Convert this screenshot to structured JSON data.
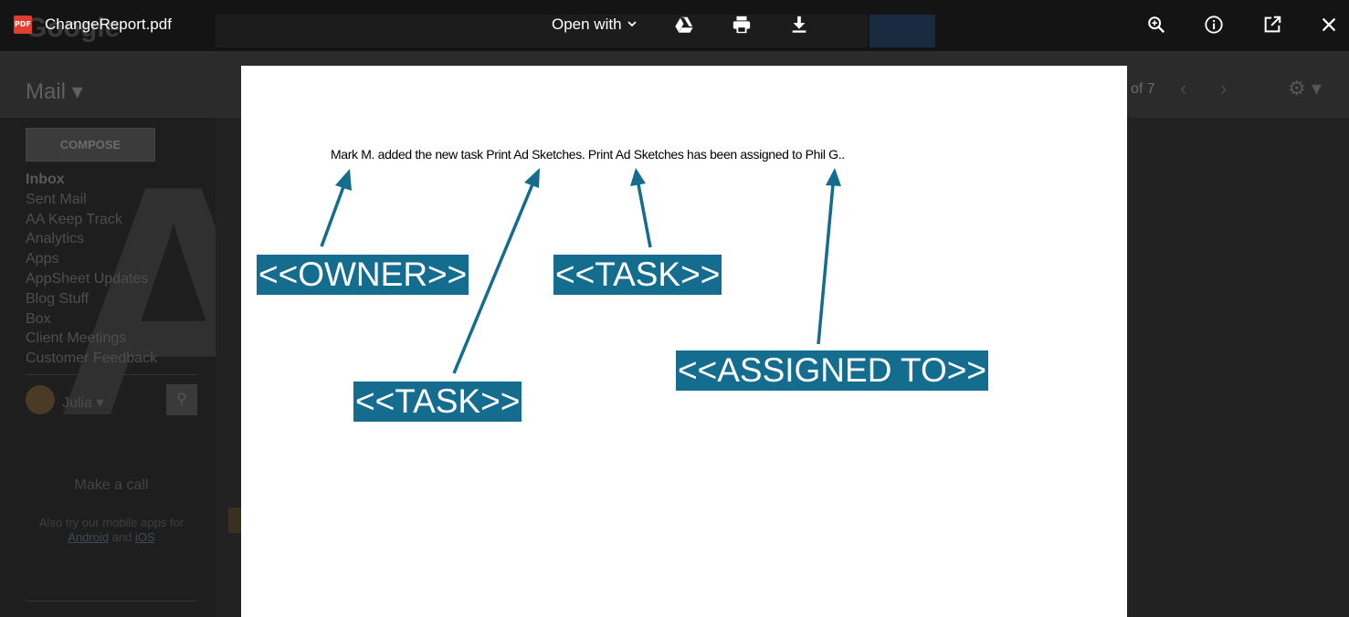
{
  "viewer": {
    "file_icon": "PDF",
    "filename": "ChangeReport.pdf",
    "open_with_label": "Open with",
    "toolbar_icons": [
      "drive-icon",
      "print-icon",
      "download-icon",
      "zoom-in-icon",
      "info-icon",
      "open-in-new-window-icon",
      "close-icon"
    ]
  },
  "document": {
    "sentence": "Mark M. added the new task Print Ad Sketches. Print Ad Sketches has been assigned to Phil G..",
    "annotations": {
      "owner": "<<OWNER>>",
      "task_first": "<<TASK>>",
      "task_second": "<<TASK>>",
      "assigned_to": "<<ASSIGNED TO>>"
    },
    "annotation_color": "#146c8f"
  },
  "background_app": {
    "logo": "Google",
    "mail_label": "Mail",
    "pager_text": "of 7",
    "compose_label": "COMPOSE",
    "labels": [
      "Inbox",
      "Sent Mail",
      "AA Keep Track",
      "Analytics",
      "Apps",
      "AppSheet Updates",
      "Blog Stuff",
      "Box",
      "Client Meetings",
      "Customer Feedback"
    ],
    "user_name": "Julia",
    "make_call": "Make a call",
    "mobile_prefix": "Also try our mobile apps for",
    "android_link": "Android",
    "and_text": "and",
    "ios_link": "iOS"
  }
}
